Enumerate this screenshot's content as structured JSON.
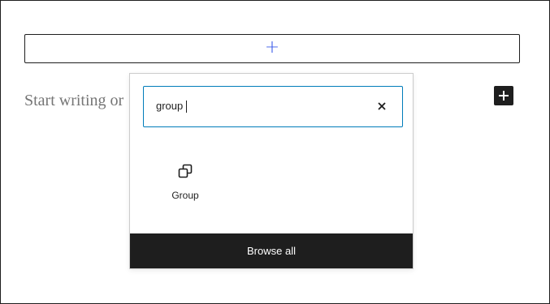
{
  "editor": {
    "appender_icon": "plus-icon",
    "placeholder": "Start writing or",
    "inline_add_icon": "plus-icon"
  },
  "inserter": {
    "search": {
      "value": "group",
      "clear_icon": "close-icon"
    },
    "results": [
      {
        "label": "Group",
        "icon": "group-block-icon"
      }
    ],
    "browse_all_label": "Browse all"
  },
  "colors": {
    "accent": "#3858e9",
    "focus_border": "#007cba",
    "dark": "#1e1e1e",
    "placeholder_text": "#757575"
  }
}
